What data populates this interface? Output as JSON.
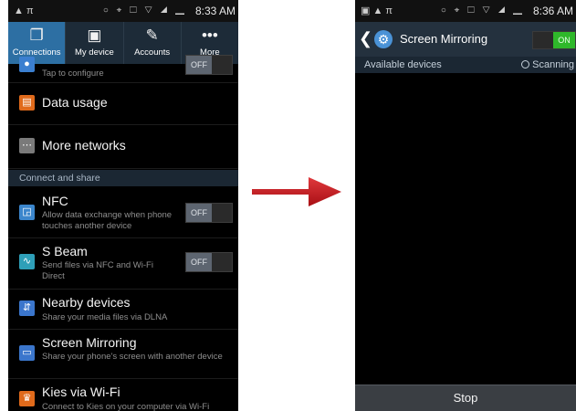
{
  "left_phone": {
    "status": {
      "left_icons": "▲ π",
      "right_icons": "○ ⌖ ☐ ▽ ◢ ▁",
      "time": "8:33 AM"
    },
    "tabs": [
      {
        "label": "Connections",
        "icon": "connections-icon",
        "glyph": "❐",
        "active": true
      },
      {
        "label": "My device",
        "icon": "my-device-icon",
        "glyph": "▣",
        "active": false
      },
      {
        "label": "Accounts",
        "icon": "accounts-icon",
        "glyph": "✎",
        "active": false
      },
      {
        "label": "More",
        "icon": "more-icon",
        "glyph": "•••",
        "active": false
      }
    ],
    "top_partial": {
      "subtitle": "Tap to configure",
      "toggle": "OFF"
    },
    "data_usage": {
      "title": "Data usage",
      "icon": "data-usage-icon"
    },
    "more_networks": {
      "title": "More networks",
      "icon": "more-networks-icon"
    },
    "section_header": "Connect and share",
    "nfc": {
      "title": "NFC",
      "subtitle": "Allow data exchange when phone touches another device",
      "toggle": "OFF",
      "icon": "nfc-icon"
    },
    "sbeam": {
      "title": "S Beam",
      "subtitle": "Send files via NFC and Wi-Fi Direct",
      "toggle": "OFF",
      "icon": "s-beam-icon"
    },
    "nearby": {
      "title": "Nearby devices",
      "subtitle": "Share your media files via DLNA",
      "icon": "nearby-devices-icon"
    },
    "mirroring": {
      "title": "Screen Mirroring",
      "subtitle": "Share your phone's screen with another device",
      "icon": "screen-mirroring-icon"
    },
    "kies": {
      "title": "Kies via Wi-Fi",
      "subtitle": "Connect to Kies on your computer via Wi-Fi",
      "icon": "kies-icon"
    }
  },
  "right_phone": {
    "status": {
      "left_icons": "▣ ▲ π",
      "right_icons": "○ ⌖ ☐ ▽ ◢ ▁",
      "time": "8:36 AM"
    },
    "title": "Screen Mirroring",
    "toggle": "ON",
    "subheader_left": "Available devices",
    "subheader_right": "Scanning",
    "stop_label": "Stop"
  },
  "colors": {
    "active_tab": "#2d6fa3",
    "arrow": "#c0151b",
    "toggle_on": "#2fb82a",
    "section_header_bg": "#1b2733"
  }
}
